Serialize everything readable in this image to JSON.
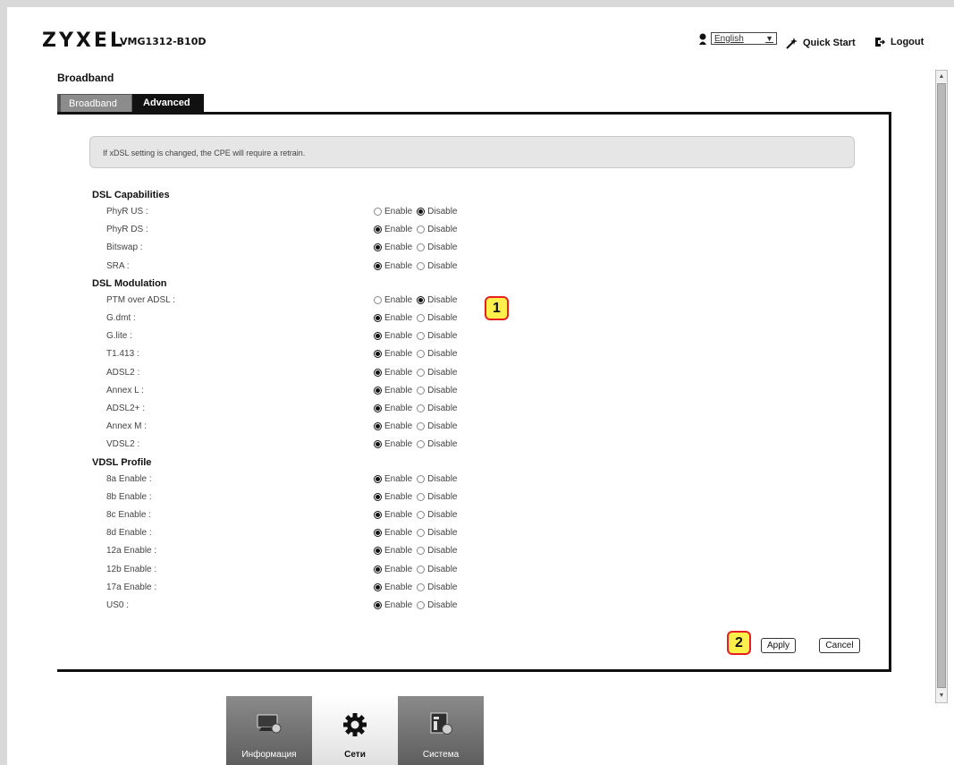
{
  "header": {
    "brand": "ZYXEL",
    "model": "VMG1312-B10D",
    "language": "English",
    "quick_start": "Quick Start",
    "logout": "Logout"
  },
  "page_title": "Broadband",
  "tabs": [
    {
      "label": "Broadband",
      "active": false
    },
    {
      "label": "Advanced",
      "active": true
    }
  ],
  "notice": "If xDSL setting is changed, the CPE will require a retrain.",
  "option_labels": {
    "enable": "Enable",
    "disable": "Disable"
  },
  "sections": [
    {
      "title": "DSL Capabilities",
      "rows": [
        {
          "label": "PhyR US :",
          "value": "Disable"
        },
        {
          "label": "PhyR DS :",
          "value": "Enable"
        },
        {
          "label": "Bitswap :",
          "value": "Enable"
        },
        {
          "label": "SRA :",
          "value": "Enable"
        }
      ]
    },
    {
      "title": "DSL Modulation",
      "rows": [
        {
          "label": "PTM over ADSL :",
          "value": "Disable"
        },
        {
          "label": "G.dmt :",
          "value": "Enable"
        },
        {
          "label": "G.lite :",
          "value": "Enable"
        },
        {
          "label": "T1.413 :",
          "value": "Enable"
        },
        {
          "label": "ADSL2 :",
          "value": "Enable"
        },
        {
          "label": "Annex L :",
          "value": "Enable"
        },
        {
          "label": "ADSL2+ :",
          "value": "Enable"
        },
        {
          "label": "Annex M :",
          "value": "Enable"
        },
        {
          "label": "VDSL2 :",
          "value": "Enable"
        }
      ]
    },
    {
      "title": "VDSL Profile",
      "rows": [
        {
          "label": "8a Enable :",
          "value": "Enable"
        },
        {
          "label": "8b Enable :",
          "value": "Enable"
        },
        {
          "label": "8c Enable :",
          "value": "Enable"
        },
        {
          "label": "8d Enable :",
          "value": "Enable"
        },
        {
          "label": "12a Enable :",
          "value": "Enable"
        },
        {
          "label": "12b Enable :",
          "value": "Enable"
        },
        {
          "label": "17a Enable :",
          "value": "Enable"
        },
        {
          "label": "US0 :",
          "value": "Enable"
        }
      ]
    }
  ],
  "callouts": [
    "1",
    "2"
  ],
  "buttons": {
    "apply": "Apply",
    "cancel": "Cancel"
  },
  "bottom_nav": [
    {
      "label": "Информация",
      "icon": "monitor-icon",
      "active": false
    },
    {
      "label": "Сети",
      "icon": "gear-icon",
      "active": true
    },
    {
      "label": "Система",
      "icon": "system-icon",
      "active": false
    }
  ],
  "colors": {
    "callout_fill": "#ffef4a",
    "callout_border": "#e62020",
    "tab_active": "#111111",
    "tab_inactive": "#8c8c8c"
  }
}
